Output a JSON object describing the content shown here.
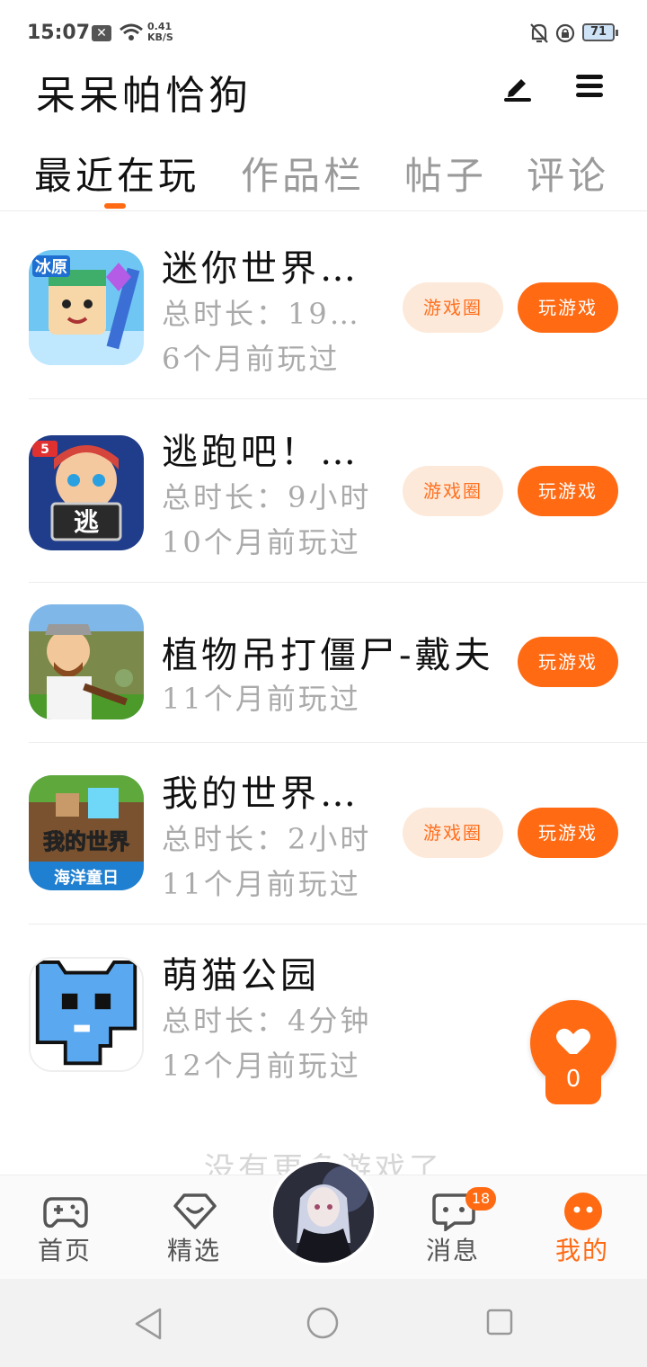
{
  "status_bar": {
    "time": "15:07",
    "x_icon": "x-notification-icon",
    "speed_value": "0.41",
    "speed_unit": "KB/S",
    "battery": "71"
  },
  "header": {
    "title": "呆呆帕恰狗",
    "edit_icon": "pen-icon",
    "menu_icon": "menu-icon"
  },
  "tabs": [
    {
      "label": "最近在玩",
      "active": true
    },
    {
      "label": "作品栏",
      "active": false
    },
    {
      "label": "帖子",
      "active": false
    },
    {
      "label": "评论",
      "active": false
    }
  ],
  "games": [
    {
      "name": "迷你世界…",
      "duration": "总时长：19…",
      "last_played": "6个月前玩过",
      "circle_label": "游戏圈",
      "play_label": "玩游戏"
    },
    {
      "name": "逃跑吧！…",
      "duration": "总时长：9小时",
      "last_played": "10个月前玩过",
      "circle_label": "游戏圈",
      "play_label": "玩游戏"
    },
    {
      "name": "植物吊打僵尸-戴夫",
      "duration": "",
      "last_played": "11个月前玩过",
      "circle_label": "",
      "play_label": "玩游戏"
    },
    {
      "name": "我的世界…",
      "duration": "总时长：2小时",
      "last_played": "11个月前玩过",
      "circle_label": "游戏圈",
      "play_label": "玩游戏"
    },
    {
      "name": "萌猫公园",
      "duration": "总时长：4分钟",
      "last_played": "12个月前玩过",
      "circle_label": "",
      "play_label": ""
    }
  ],
  "icon_texts": {
    "game1_badge": "冰原",
    "game2_badge": "逃",
    "game4_banner": "海洋童日",
    "game4_logo": "我的世界"
  },
  "footer_note": "没有更多游戏了",
  "float_widget": {
    "icon": "heart-icon",
    "count": "0"
  },
  "bottom_nav": [
    {
      "label": "首页",
      "icon": "gamepad-icon"
    },
    {
      "label": "精选",
      "icon": "heart-gem-icon"
    },
    {
      "label": "",
      "icon": "avatar"
    },
    {
      "label": "消息",
      "icon": "chat-icon",
      "badge": "18"
    },
    {
      "label": "我的",
      "icon": "face-icon",
      "active": true
    }
  ],
  "colors": {
    "accent": "#ff6a13",
    "circle_btn_bg": "#fde9d9",
    "meta_text": "#aaaaaa"
  }
}
